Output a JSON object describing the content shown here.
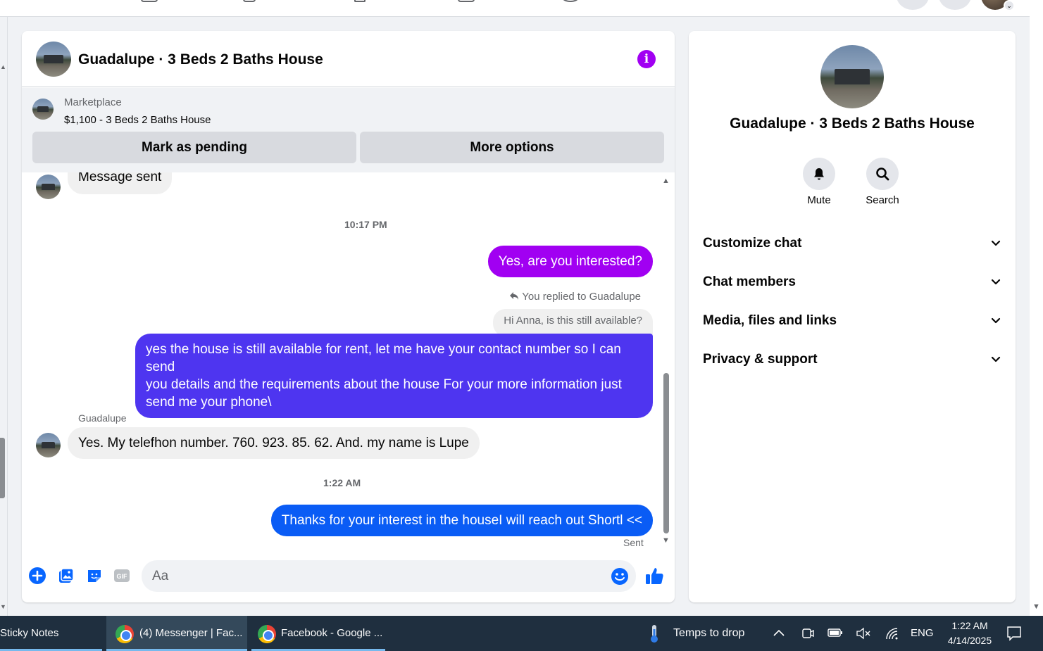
{
  "chat": {
    "title": "Guadalupe · 3 Beds 2 Baths House",
    "marketplace_label": "Marketplace",
    "listing": "$1,100 - 3 Beds 2 Baths House",
    "mark_pending_label": "Mark as pending",
    "more_options_label": "More options"
  },
  "messages": {
    "first_incoming": "Message sent",
    "time_1": "10:17 PM",
    "outgoing_1": "Yes, are you interested?",
    "reply_note": "You replied to Guadalupe",
    "quoted_text": "Hi Anna, is this still available?",
    "outgoing_2_lines": [
      "yes the house is still available for rent, let me have your contact number so I can send",
      "you details and the requirements about the house For  your  more  information  just",
      "send  me   your  phone\\"
    ],
    "sender_name": "Guadalupe",
    "incoming_2": "Yes. My telefhon number. 760. 923. 85. 62.   And. my name is Lupe",
    "time_2": "1:22 AM",
    "outgoing_3": "Thanks for your interest in the houseI will reach out Shortl <<",
    "status": "Sent"
  },
  "composer": {
    "placeholder": "Aa"
  },
  "info": {
    "title": "Guadalupe · 3 Beds 2 Baths House",
    "mute_label": "Mute",
    "search_label": "Search",
    "sections": [
      "Customize chat",
      "Chat members",
      "Media, files and links",
      "Privacy & support"
    ]
  },
  "taskbar": {
    "sticky_notes": "Sticky Notes",
    "messenger_tab": "(4) Messenger | Fac...",
    "facebook_tab": "Facebook - Google ...",
    "weather": "Temps to drop",
    "language": "ENG",
    "time": "1:22 AM",
    "date": "4/14/2025"
  },
  "colors": {
    "messenger_purple": "#a100f2",
    "bubble_purple": "#a100f2",
    "bubble_indigo": "#4e35f0",
    "bubble_blue": "#0a5cf5",
    "facebook_blue": "#0866ff"
  },
  "icons": [
    "info-icon",
    "bell-icon",
    "search-icon",
    "chevron-down-icon",
    "plus-icon",
    "photo-icon",
    "sticker-icon",
    "gif-icon",
    "emoji-icon",
    "thumbs-up-icon",
    "reply-icon",
    "chrome-icon",
    "thermometer-icon"
  ]
}
